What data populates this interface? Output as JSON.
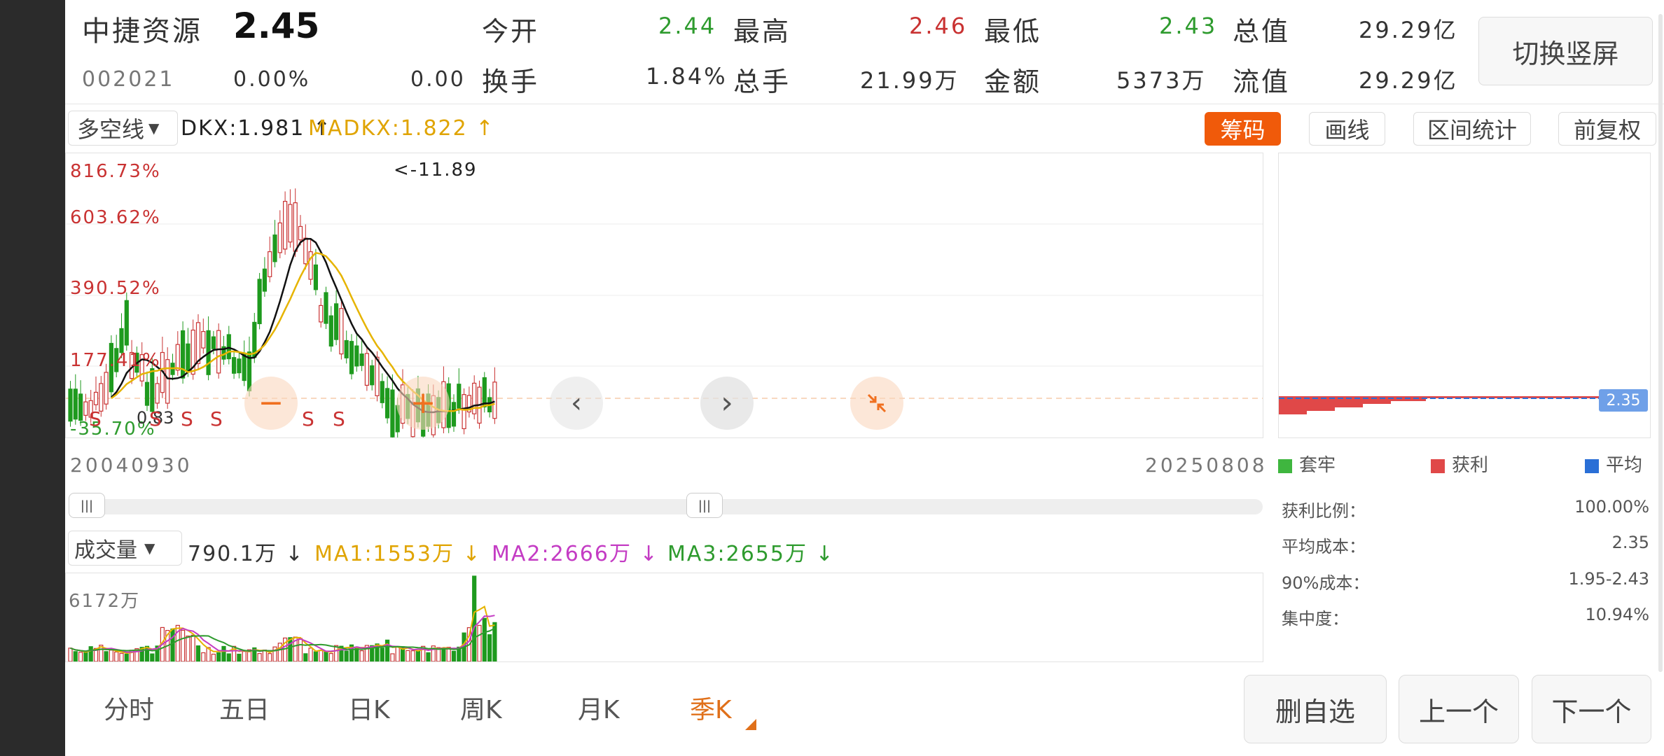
{
  "header": {
    "stock_name": "中捷资源",
    "price": "2.45",
    "code": "002021",
    "change_pct": "0.00%",
    "change": "0.00",
    "open_label": "今开",
    "open": "2.44",
    "high_label": "最高",
    "high": "2.46",
    "low_label": "最低",
    "low": "2.43",
    "total_value_label": "总值",
    "total_value": "29.29亿",
    "turnover_label": "换手",
    "turnover": "1.84%",
    "total_hands_label": "总手",
    "total_hands": "21.99万",
    "amount_label": "金额",
    "amount": "5373万",
    "float_value_label": "流值",
    "float_value": "29.29亿",
    "switch_label": "切换竖屏"
  },
  "indicator_bar": {
    "indicator_select": "多空线",
    "dkx": "DKX:1.981 ↑",
    "madkx": "MADKX:1.822 ↑",
    "chip_label": "筹码",
    "draw_label": "画线",
    "range_stats_label": "区间统计",
    "adjust_label": "前复权"
  },
  "kline": {
    "y_labels": [
      "816.73%",
      "603.62%",
      "390.52%",
      "177.41%",
      "-35.70%"
    ],
    "max_note": "<-11.89",
    "current_price_tag": "2.35",
    "markers_s": [
      "S",
      "S",
      "S",
      "S",
      "S",
      "S"
    ],
    "low_note": "0.83",
    "date_start": "20040930",
    "date_end": "20250808"
  },
  "chips": {
    "legend_trapped": "套牢",
    "legend_profit": "获利",
    "legend_avg": "平均",
    "stats": [
      {
        "label": "获利比例：",
        "value": "100.00%"
      },
      {
        "label": "平均成本：",
        "value": "2.35"
      },
      {
        "label": "90%成本：",
        "value": "1.95-2.43"
      },
      {
        "label": "集中度：",
        "value": "10.94%"
      }
    ]
  },
  "volume": {
    "select": "成交量",
    "vol": "790.1万 ↓",
    "ma1": "MA1:1553万 ↓",
    "ma2": "MA2:2666万 ↓",
    "ma3": "MA3:2655万 ↓",
    "max_label": "6172万"
  },
  "tabs": [
    "分时",
    "五日",
    "日K",
    "周K",
    "月K",
    "季K"
  ],
  "active_tab": "季K",
  "bottom_buttons": {
    "delete": "删自选",
    "prev": "上一个",
    "next": "下一个"
  },
  "colors": {
    "up": "#c93232",
    "down": "#1e9a1e",
    "accent": "#f05a0a",
    "ma_yellow": "#e6b400",
    "ma_black": "#111111"
  },
  "icons": [
    "zoom-out-icon",
    "zoom-in-icon",
    "chevron-left-icon",
    "chevron-right-icon",
    "collapse-icon",
    "dropdown-icon"
  ]
}
